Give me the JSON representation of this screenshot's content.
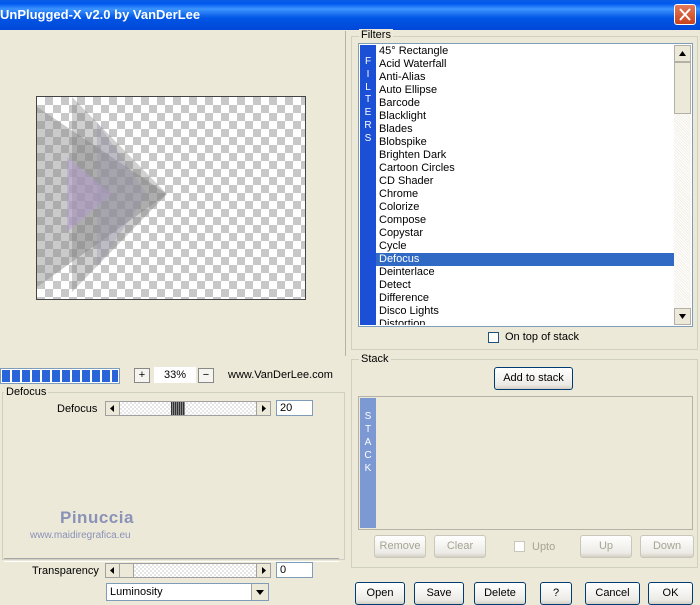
{
  "window": {
    "title": "UnPlugged-X v2.0 by VanDerLee"
  },
  "preview": {
    "zoom": "33%",
    "website": "www.VanDerLee.com",
    "progress": 1.0
  },
  "defocus_group": {
    "title": "Defocus",
    "param_label": "Defocus",
    "param_value": "20",
    "slider_fraction": 0.5
  },
  "watermark": {
    "name": "Pinuccia",
    "url": "www.maidiregrafica.eu"
  },
  "transparency": {
    "label": "Transparency",
    "value": "0",
    "blend_mode": "Luminosity"
  },
  "filters": {
    "title": "Filters",
    "tab_letters": [
      "F",
      "I",
      "L",
      "T",
      "E",
      "R",
      "S"
    ],
    "items": [
      "45° Rectangle",
      "Acid Waterfall",
      "Anti-Alias",
      "Auto Ellipse",
      "Barcode",
      "Blacklight",
      "Blades",
      "Blobspike",
      "Brighten Dark",
      "Cartoon Circles",
      "CD Shader",
      "Chrome",
      "Colorize",
      "Compose",
      "Copystar",
      "Cycle",
      "Defocus",
      "Deinterlace",
      "Detect",
      "Difference",
      "Disco Lights",
      "Distortion"
    ],
    "selected": "Defocus",
    "on_top_label": "On top of stack"
  },
  "stack": {
    "title": "Stack",
    "add_label": "Add to stack",
    "tab_letters": [
      "S",
      "T",
      "A",
      "C",
      "K"
    ],
    "remove_label": "Remove",
    "clear_label": "Clear",
    "upto_label": "Upto",
    "up_label": "Up",
    "down_label": "Down"
  },
  "footer": {
    "open": "Open",
    "save": "Save",
    "delete": "Delete",
    "help": "?",
    "cancel": "Cancel",
    "ok": "OK"
  },
  "colors": {
    "selection": "#316ac5",
    "filters_tab": "#1a4fd6",
    "stack_tab": "#7d99d4"
  }
}
